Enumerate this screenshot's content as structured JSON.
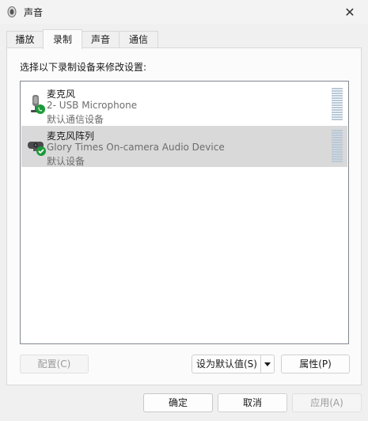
{
  "window": {
    "title": "声音",
    "close_glyph": "✕"
  },
  "tabs": [
    {
      "label": "播放",
      "active": false
    },
    {
      "label": "录制",
      "active": true
    },
    {
      "label": "声音",
      "active": false
    },
    {
      "label": "通信",
      "active": false
    }
  ],
  "panel": {
    "instruction": "选择以下录制设备来修改设置:",
    "devices": [
      {
        "name": "麦克风",
        "description": "2- USB Microphone",
        "status": "默认通信设备",
        "icon": "microphone-icon",
        "badge": "phone-badge-icon",
        "selected": false
      },
      {
        "name": "麦克风阵列",
        "description": "Glory Times On-camera Audio Device",
        "status": "默认设备",
        "icon": "webcam-microphone-icon",
        "badge": "check-badge-icon",
        "selected": true
      }
    ],
    "configure_label": "配置(C)",
    "set_default_label": "设为默认值(S)",
    "properties_label": "属性(P)"
  },
  "footer": {
    "ok_label": "确定",
    "cancel_label": "取消",
    "apply_label": "应用(A)"
  },
  "colors": {
    "badge_green": "#1c9a3a",
    "selection": "#d9d9d9",
    "level_meter": "#b9c9d8"
  }
}
